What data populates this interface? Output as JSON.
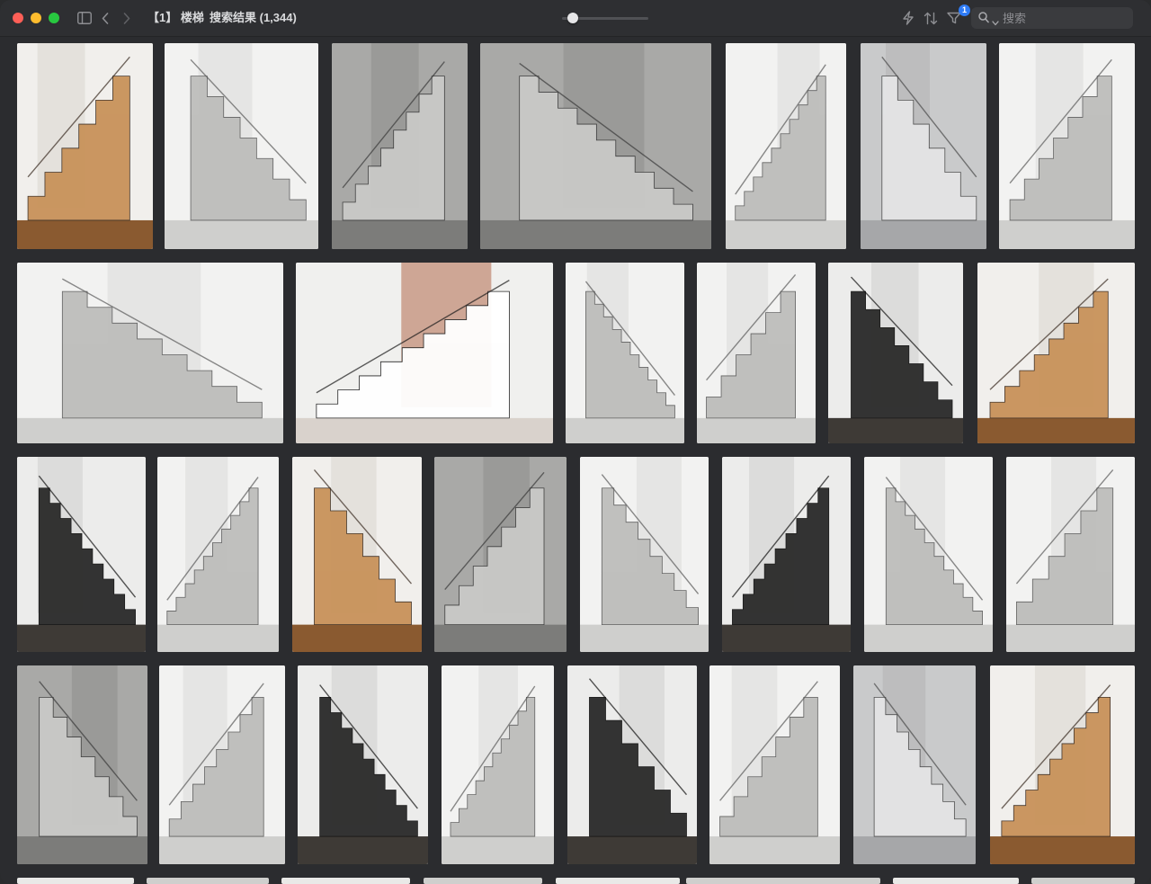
{
  "window": {
    "traffic_lights": [
      "close",
      "minimize",
      "maximize"
    ],
    "colors": {
      "close": "#fe5f57",
      "minimize": "#febc2e",
      "maximize": "#28c840",
      "accent": "#2f7cf6"
    }
  },
  "toolbar": {
    "folder_label": "【1】 楼梯",
    "separator": "›",
    "current_label": "搜索结果 (1,344)",
    "thumbnail_size_level": 0.12,
    "filter_badge": "1",
    "search_placeholder": "搜索"
  },
  "grid": {
    "rows": [
      {
        "items": [
          {
            "name": "wooden-zigzag-bookshelf-stair",
            "style": "wood"
          },
          {
            "name": "white-void-stair",
            "style": "white"
          },
          {
            "name": "concrete-recess-stair",
            "style": "concrete"
          },
          {
            "name": "concrete-handrail-closeup",
            "style": "concrete"
          },
          {
            "name": "white-corridor-stair",
            "style": "white"
          },
          {
            "name": "marble-stair-walking-figure",
            "style": "marble"
          },
          {
            "name": "white-railing-stair",
            "style": "white"
          }
        ]
      },
      {
        "items": [
          {
            "name": "white-atrium-bridge",
            "style": "white"
          },
          {
            "name": "brick-wall-ladder-stair",
            "style": "brick"
          },
          {
            "name": "white-stair-walking-man",
            "style": "white"
          },
          {
            "name": "sculpted-white-stair",
            "style": "white"
          },
          {
            "name": "black-steel-spiral-stair",
            "style": "dark"
          },
          {
            "name": "wooden-zigzag-bookshelf-stair",
            "style": "wood"
          }
        ]
      },
      {
        "items": [
          {
            "name": "suspended-rod-stair",
            "style": "dark"
          },
          {
            "name": "white-skylight-stair",
            "style": "white"
          },
          {
            "name": "wood-balustrade-skylight",
            "style": "wood"
          },
          {
            "name": "concrete-corridor-stair",
            "style": "concrete"
          },
          {
            "name": "white-wall-black-stair",
            "style": "white"
          },
          {
            "name": "black-floating-treads",
            "style": "dark"
          },
          {
            "name": "white-curved-stair-pendant",
            "style": "white"
          },
          {
            "name": "white-stair-book-shelves",
            "style": "white"
          }
        ]
      },
      {
        "items": [
          {
            "name": "concrete-white-block-stair",
            "style": "concrete"
          },
          {
            "name": "white-landing-stair",
            "style": "white"
          },
          {
            "name": "suspended-rod-stair",
            "style": "dark"
          },
          {
            "name": "white-spiral-stair",
            "style": "white"
          },
          {
            "name": "black-treads-glass-rail",
            "style": "dark"
          },
          {
            "name": "glass-curved-stair",
            "style": "white"
          },
          {
            "name": "marble-stair",
            "style": "marble"
          },
          {
            "name": "wooden-straight-stair",
            "style": "wood"
          }
        ]
      }
    ]
  }
}
